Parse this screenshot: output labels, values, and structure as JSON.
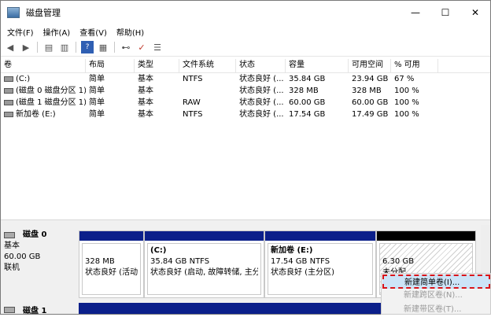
{
  "window": {
    "title": "磁盘管理",
    "minimize_glyph": "—",
    "maximize_glyph": "☐",
    "close_glyph": "✕"
  },
  "menu": [
    "文件(F)",
    "操作(A)",
    "查看(V)",
    "帮助(H)"
  ],
  "toolbar": [
    "back-icon",
    "forward-icon",
    "properties-icon",
    "help-icon",
    "rescan-icon",
    "check-icon",
    "list-icon"
  ],
  "table": {
    "headers": [
      "卷",
      "布局",
      "类型",
      "文件系统",
      "状态",
      "容量",
      "可用空间",
      "% 可用"
    ],
    "rows": [
      [
        "(C:)",
        "简单",
        "基本",
        "NTFS",
        "状态良好 (...",
        "35.84 GB",
        "23.94 GB",
        "67 %"
      ],
      [
        "(磁盘 0 磁盘分区 1)",
        "简单",
        "基本",
        "",
        "状态良好 (...",
        "328 MB",
        "328 MB",
        "100 %"
      ],
      [
        "(磁盘 1 磁盘分区 1)",
        "简单",
        "基本",
        "RAW",
        "状态良好 (...",
        "60.00 GB",
        "60.00 GB",
        "100 %"
      ],
      [
        "新加卷 (E:)",
        "简单",
        "基本",
        "NTFS",
        "状态良好 (...",
        "17.54 GB",
        "17.49 GB",
        "100 %"
      ]
    ]
  },
  "disk0": {
    "name": "磁盘 0",
    "type": "基本",
    "size": "60.00 GB",
    "status": "联机",
    "partitions": [
      {
        "title": "",
        "size": "328 MB",
        "status": "状态良好 (活动,"
      },
      {
        "title": "(C:)",
        "size": "35.84 GB NTFS",
        "status": "状态良好 (启动, 故障转储, 主分"
      },
      {
        "title": "新加卷  (E:)",
        "size": "17.54 GB NTFS",
        "status": "状态良好 (主分区)"
      },
      {
        "title": "",
        "size": "6.30 GB",
        "status": "未分配"
      }
    ]
  },
  "disk1": {
    "name": "磁盘 1"
  },
  "context_menu": [
    "新建简单卷(I)...",
    "新建跨区卷(N)...",
    "新建带区卷(T)..."
  ],
  "colors": {
    "primary_partition": "#0b1f8a",
    "unallocated": "#000000",
    "highlight_dash": "#d8151b"
  }
}
